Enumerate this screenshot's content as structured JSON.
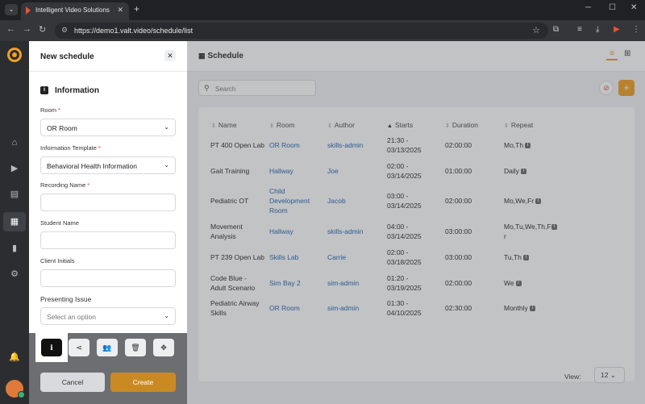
{
  "browser": {
    "tab_title": "Intelligent Video Solutions",
    "url": "https://demo1.valt.video/schedule/list"
  },
  "main": {
    "title": "Schedule",
    "search_placeholder": "Search",
    "columns": [
      "Name",
      "Room",
      "Author",
      "Starts",
      "Duration",
      "Repeat"
    ],
    "rows": [
      {
        "name": "PT 400 Open Lab",
        "room": "OR Room",
        "author": "skills-admin",
        "starts": "21:30 -\n03/13/2025",
        "duration": "02:00:00",
        "repeat": "Mo,Th"
      },
      {
        "name": "Gait Training",
        "room": "Hallway",
        "author": "Joe",
        "starts": "02:00 -\n03/14/2025",
        "duration": "01:00:00",
        "repeat": "Daily"
      },
      {
        "name": "Pediatric OT",
        "room": "Child\nDevelopment\nRoom",
        "author": "Jacob",
        "starts": "03:00 -\n03/14/2025",
        "duration": "02:00:00",
        "repeat": "Mo,We,Fr"
      },
      {
        "name": "Movement\nAnalysis",
        "room": "Hallway",
        "author": "skills-admin",
        "starts": "04:00 -\n03/14/2025",
        "duration": "03:00:00",
        "repeat": "Mo,Tu,We,Th,F\nr"
      },
      {
        "name": "PT 239 Open Lab",
        "room": "Skills Lab",
        "author": "Carrie",
        "starts": "02:00 -\n03/18/2025",
        "duration": "03:00:00",
        "repeat": "Tu,Th"
      },
      {
        "name": "Code Blue -\nAdult Scenario",
        "room": "Sim Bay 2",
        "author": "sim-admin",
        "starts": "01:20 -\n03/19/2025",
        "duration": "02:00:00",
        "repeat": "We"
      },
      {
        "name": "Pediatric Airway\nSkills",
        "room": "OR Room",
        "author": "sim-admin",
        "starts": "01:30 -\n04/10/2025",
        "duration": "02:30:00",
        "repeat": "Monthly"
      }
    ],
    "view_label": "View:",
    "view_value": "12"
  },
  "drawer": {
    "title": "New schedule",
    "section": "Information",
    "fields": {
      "room": {
        "label": "Room",
        "value": "OR Room"
      },
      "template": {
        "label": "Information Template",
        "value": "Behavioral Health Information"
      },
      "recording": {
        "label": "Recording Name"
      },
      "student": {
        "label": "Student Name"
      },
      "client": {
        "label": "Client Initials"
      },
      "issue": {
        "label": "Presenting Issue",
        "placeholder": "Select an option"
      }
    },
    "required_mark": "*",
    "cancel_label": "Cancel",
    "create_label": "Create"
  },
  "colors": {
    "accent": "#f09a1c",
    "link": "#1a5fb4",
    "sidebar": "#2b2d30"
  }
}
